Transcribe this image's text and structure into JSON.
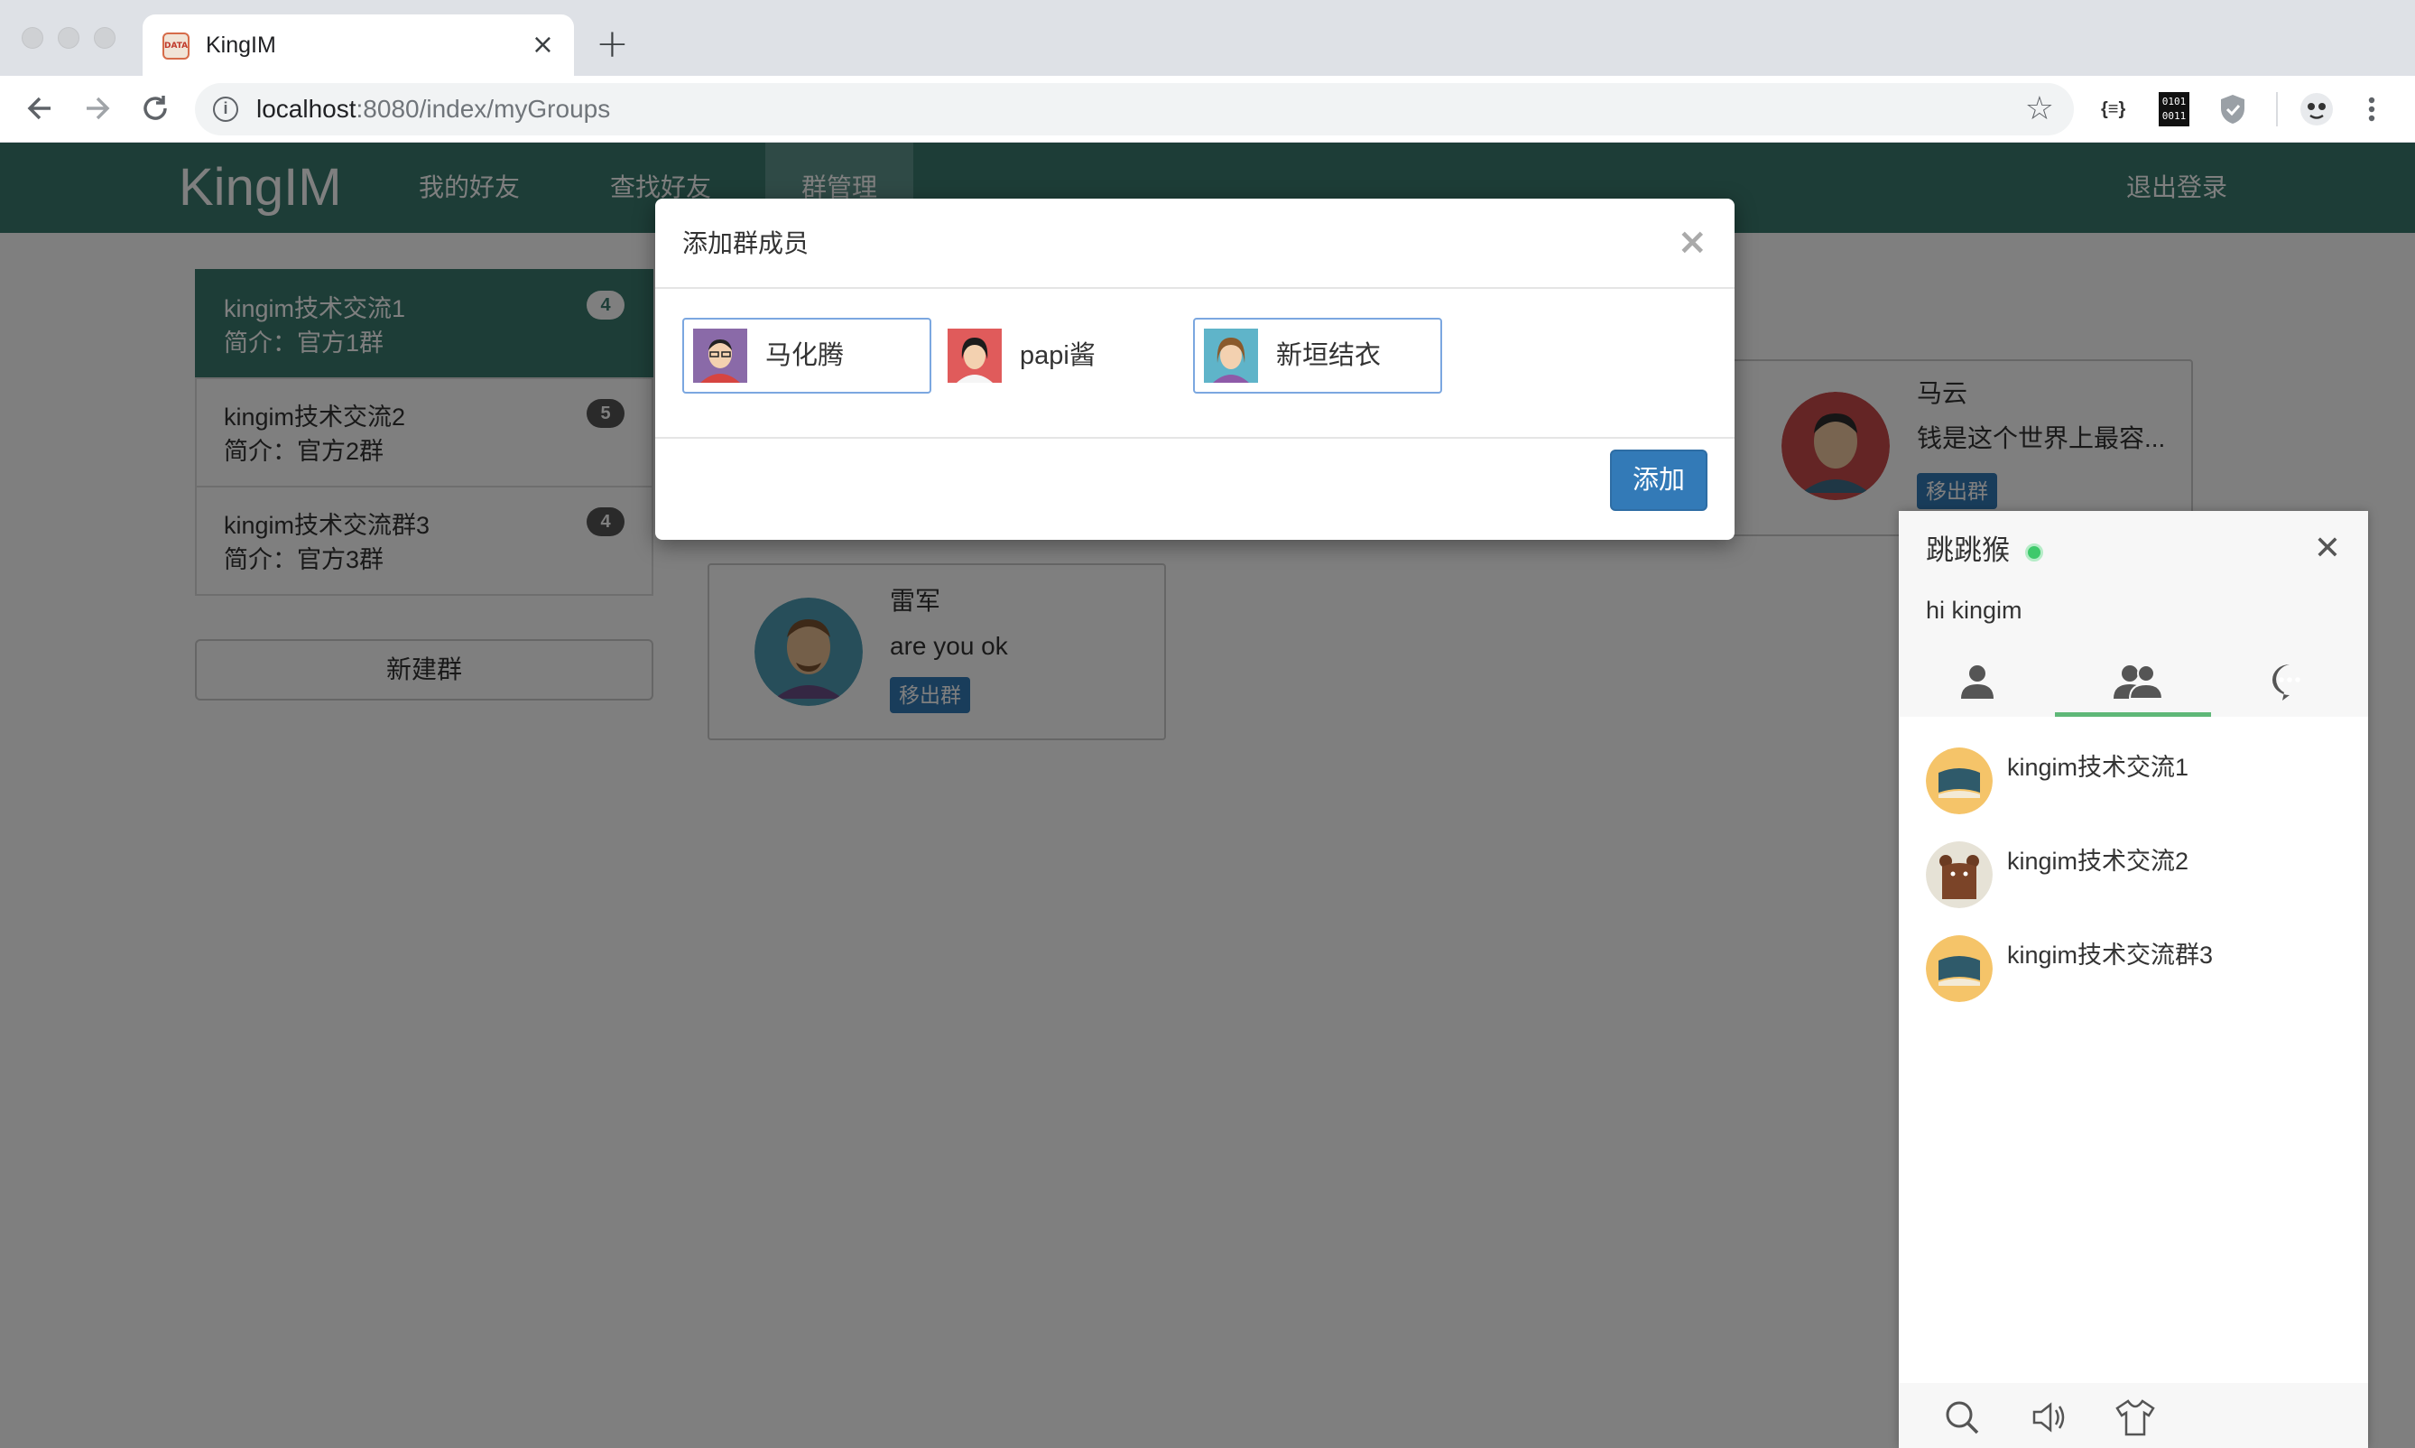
{
  "browser": {
    "tab_title": "KingIM",
    "tab_favicon_text": "DATA",
    "tab_close": "×",
    "new_tab": "+",
    "url_host": "localhost",
    "url_rest": ":8080/index/myGroups",
    "ext_json_label": "{≡}",
    "ext_binary_label": "0101 0011"
  },
  "navbar": {
    "brand": "KingIM",
    "links": [
      "我的好友",
      "查找好友",
      "群管理"
    ],
    "active_index": 2,
    "logout": "退出登录"
  },
  "groups": [
    {
      "name": "kingim技术交流1",
      "desc": "简介：官方1群",
      "count": "4",
      "active": true
    },
    {
      "name": "kingim技术交流2",
      "desc": "简介：官方2群",
      "count": "5",
      "active": false
    },
    {
      "name": "kingim技术交流群3",
      "desc": "简介：官方3群",
      "count": "4",
      "active": false
    }
  ],
  "new_group_label": "新建群",
  "members": [
    {
      "name": "马云",
      "sig": "钱是这个世界上最容...",
      "remove": "移出群"
    },
    {
      "name": "雷军",
      "sig": "are you ok",
      "remove": "移出群"
    }
  ],
  "modal": {
    "title": "添加群成员",
    "close": "×",
    "candidates": [
      {
        "name": "马化腾",
        "selected": true
      },
      {
        "name": "papi酱",
        "selected": false
      },
      {
        "name": "新垣结衣",
        "selected": true
      }
    ],
    "add_label": "添加"
  },
  "chat": {
    "user": "跳跳猴",
    "status": "hi kingim",
    "close": "✕",
    "active_tab": 1,
    "groups": [
      {
        "name": "kingim技术交流1"
      },
      {
        "name": "kingim技术交流2"
      },
      {
        "name": "kingim技术交流群3"
      }
    ]
  },
  "colors": {
    "navbar": "#3a7a6f",
    "primary_button": "#337ab7",
    "online": "#3ec96b",
    "tab_underline": "#5fb878"
  }
}
